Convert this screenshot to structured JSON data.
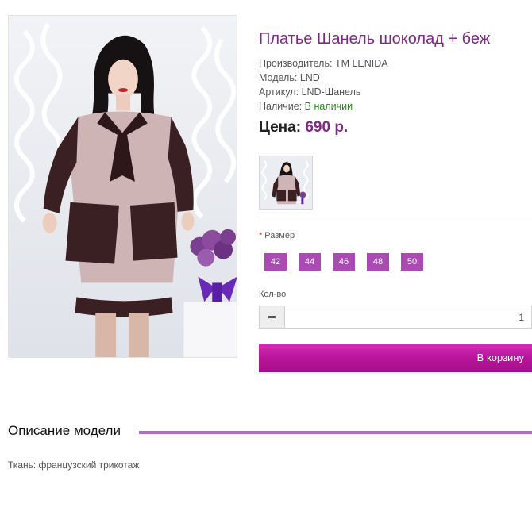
{
  "product": {
    "title": "Платье Шанель шоколад + беж",
    "manufacturer_label": "Производитель:",
    "manufacturer_value": "ТМ LENIDA",
    "model_label": "Модель:",
    "model_value": "LND",
    "sku_label": "Артикул:",
    "sku_value": "LND-Шанель",
    "availability_label": "Наличие:",
    "availability_value": "В наличии",
    "price_label": "Цена:",
    "price_value": "690 р."
  },
  "options": {
    "size_label": "Размер",
    "required_mark": "*",
    "sizes": [
      "42",
      "44",
      "46",
      "48",
      "50"
    ]
  },
  "quantity": {
    "label": "Кол-во",
    "value": "1"
  },
  "cart": {
    "button_label": "В корзину"
  },
  "description": {
    "heading": "Описание модели",
    "text": "Ткань: французский трикотаж"
  },
  "colors": {
    "accent_purple": "#7b2b82",
    "size_button": "#a94bb3",
    "cart_gradient_top": "#d02fb6",
    "cart_gradient_bottom": "#a60f8a",
    "in_stock_green": "#2a8a1e",
    "required_red": "#d9262c"
  }
}
